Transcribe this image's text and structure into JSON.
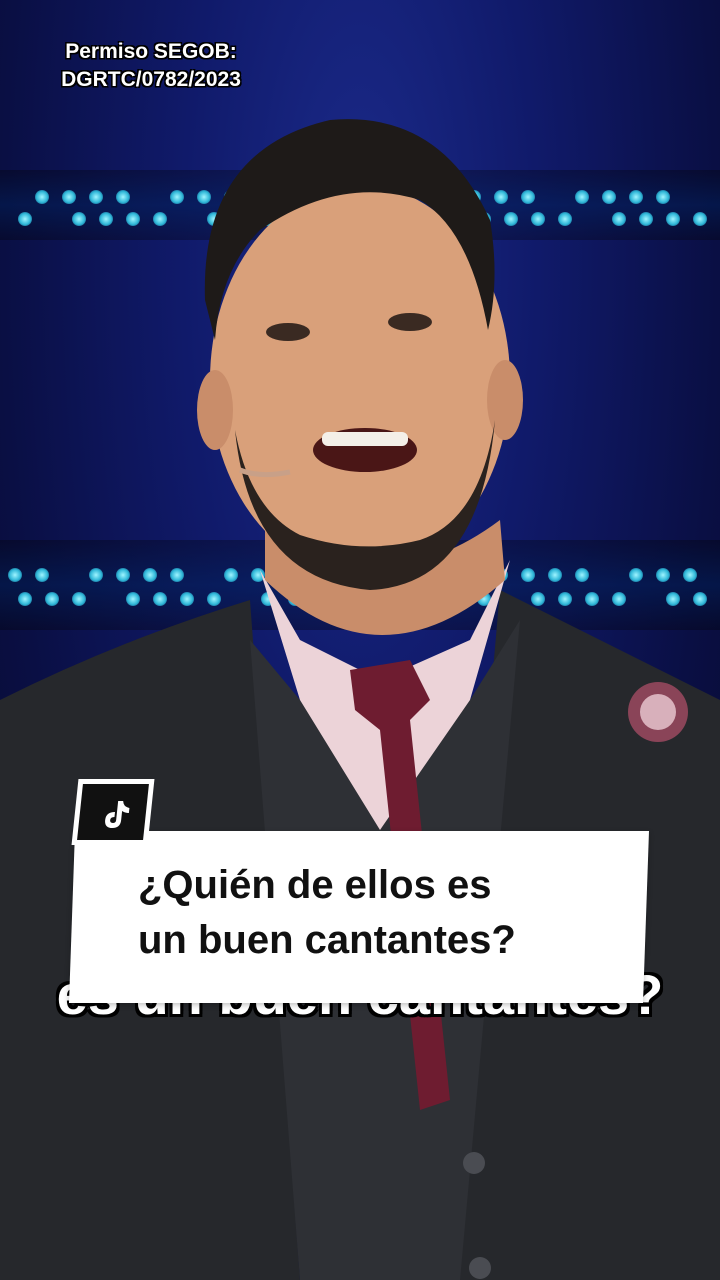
{
  "watermark": {
    "line1": "Permiso SEGOB:",
    "line2": "DGRTC/0782/2023"
  },
  "caption": {
    "line1": "¿Quién de ellos es",
    "line2": "un buen cantantes?"
  },
  "subtitle": {
    "text": "es un buen cantantes?"
  },
  "icons": {
    "logo": "tiktok-icon"
  },
  "colors": {
    "background": "#0a0f44",
    "stage_lights": "#2fb7d8",
    "caption_bg": "#ffffff",
    "caption_text": "#111111",
    "tie": "#6e1c30",
    "suit": "#26282c",
    "shirt": "#ecd3d8"
  }
}
